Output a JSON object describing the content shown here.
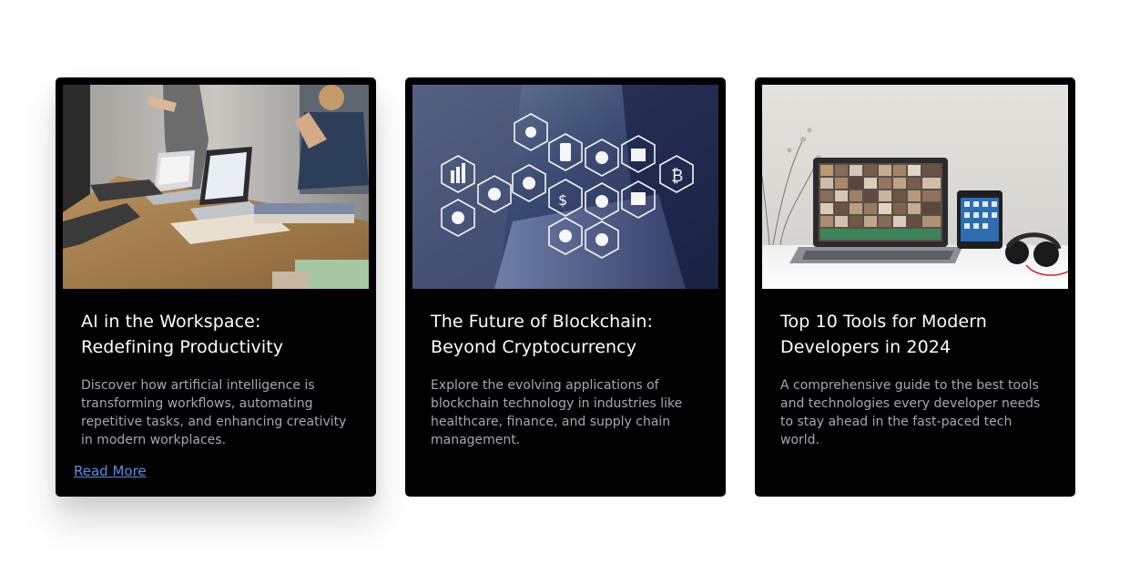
{
  "cards": [
    {
      "title": "AI in the Workspace: Redefining Productivity",
      "description": "Discover how artificial intelligence is transforming workflows, automating repetitive tasks, and enhancing creativity in modern workplaces.",
      "link_label": "Read More",
      "image": "office-meeting-laptops-photo"
    },
    {
      "title": "The Future of Blockchain: Beyond Cryptocurrency",
      "description": "Explore the evolving applications of blockchain technology in industries like healthcare, finance, and supply chain management.",
      "image": "blockchain-hexagon-icons-photo"
    },
    {
      "title": "Top 10 Tools for Modern Developers in 2024",
      "description": "A comprehensive guide to the best tools and technologies every developer needs to stay ahead in the fast-paced tech world.",
      "image": "laptop-tablet-headphones-photo"
    }
  ],
  "colors": {
    "card_bg": "#000000",
    "title": "#ffffff",
    "description": "#a7a7b2",
    "link": "#5a8fe6",
    "page_bg": "#ffffff"
  }
}
